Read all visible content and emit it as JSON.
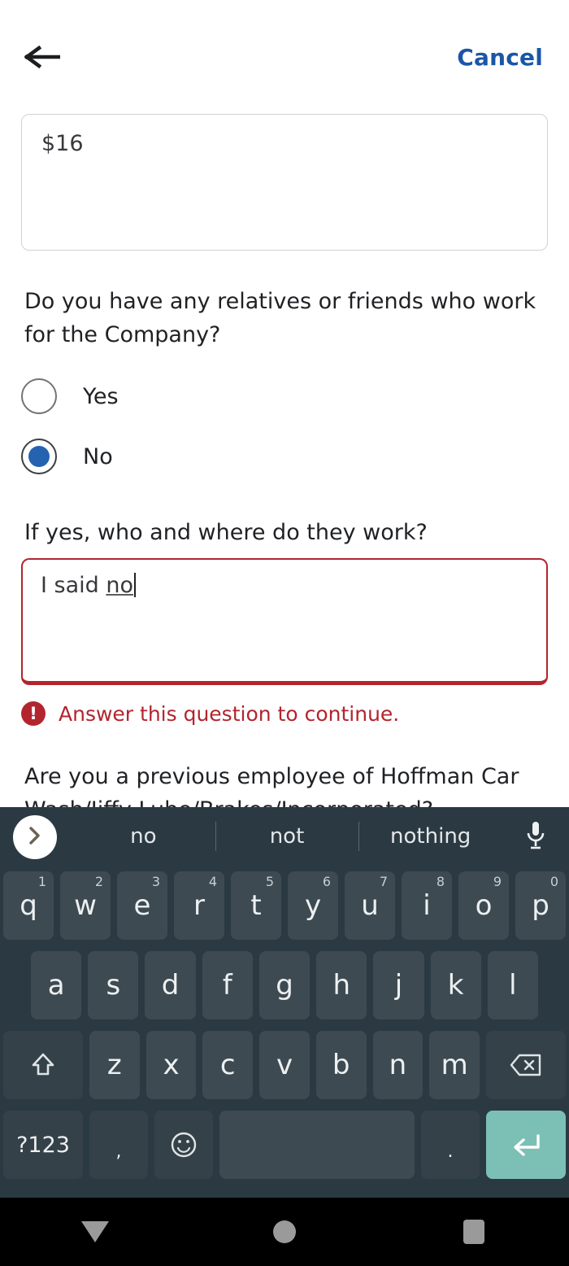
{
  "header": {
    "back_icon": "arrow-left-icon",
    "cancel_label": "Cancel"
  },
  "form": {
    "salary_field": {
      "value": "$16",
      "placeholder": ""
    },
    "question_1": "Do you have any relatives or friends who work for the Company?",
    "radio_options": [
      {
        "label": "Yes",
        "selected": false
      },
      {
        "label": "No",
        "selected": true
      }
    ],
    "question_2": "If yes, who and where do they work?",
    "answer_field": {
      "text_before": "I said ",
      "text_composing": "no",
      "placeholder": ""
    },
    "error": {
      "icon": "exclamation-circle-icon",
      "message": "Answer this question to continue.",
      "color": "#b3252e"
    },
    "question_3_line1": "Are you a previous employee of Hoffman Car",
    "question_3_line2": "Wash/Jiffy Lube/Brakes/Incorporated?"
  },
  "keyboard": {
    "expand_icon": "chevron-right-icon",
    "mic_icon": "microphone-icon",
    "suggestions": [
      "no",
      "not",
      "nothing"
    ],
    "row1": [
      {
        "key": "q",
        "num": "1"
      },
      {
        "key": "w",
        "num": "2"
      },
      {
        "key": "e",
        "num": "3"
      },
      {
        "key": "r",
        "num": "4"
      },
      {
        "key": "t",
        "num": "5"
      },
      {
        "key": "y",
        "num": "6"
      },
      {
        "key": "u",
        "num": "7"
      },
      {
        "key": "i",
        "num": "8"
      },
      {
        "key": "o",
        "num": "9"
      },
      {
        "key": "p",
        "num": "0"
      }
    ],
    "row2": [
      "a",
      "s",
      "d",
      "f",
      "g",
      "h",
      "j",
      "k",
      "l"
    ],
    "row3_letters": [
      "z",
      "x",
      "c",
      "v",
      "b",
      "n",
      "m"
    ],
    "shift_icon": "shift-arrow-icon",
    "backspace_icon": "backspace-icon",
    "symbols_label": "?123",
    "comma_label": ",",
    "emoji_icon": "smiley-face-icon",
    "space_label": "",
    "period_label": ".",
    "enter_icon": "enter-return-icon",
    "enter_color": "#7cbfb5",
    "bg_color": "#2b3a42",
    "key_color": "#3d4a52"
  },
  "navbar": {
    "back_icon": "nav-back-triangle-icon",
    "home_icon": "nav-home-circle-icon",
    "recents_icon": "nav-recents-square-icon"
  }
}
